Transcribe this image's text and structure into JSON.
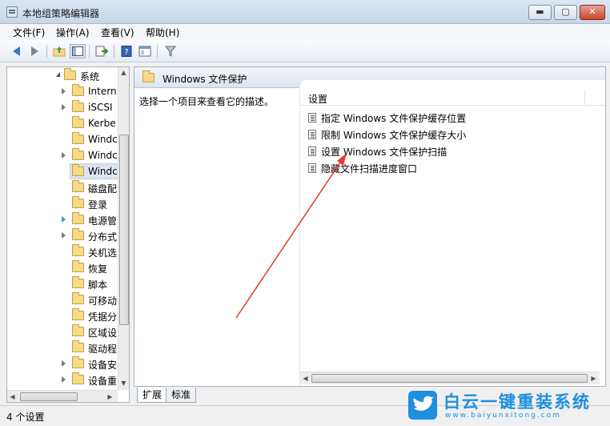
{
  "window": {
    "title": "本地组策略编辑器",
    "min_label": "▬",
    "max_label": "▢",
    "close_label": "✕"
  },
  "menu": {
    "items": [
      "文件(F)",
      "操作(A)",
      "查看(V)",
      "帮助(H)"
    ]
  },
  "toolbar": {
    "icons": [
      "back-arrow-icon",
      "forward-arrow-icon",
      "up-folder-icon",
      "show-hide-tree-icon",
      "export-list-icon",
      "help-icon",
      "properties-icon",
      "filter-icon"
    ]
  },
  "tree": {
    "items": [
      {
        "label": "系统",
        "expander": "open"
      },
      {
        "label": "Intern",
        "expander": "closed"
      },
      {
        "label": "iSCSI",
        "expander": "closed"
      },
      {
        "label": "Kerbe",
        "expander": "none"
      },
      {
        "label": "Windc",
        "expander": "none"
      },
      {
        "label": "Windc",
        "expander": "closed"
      },
      {
        "label": "Windc",
        "expander": "none",
        "selected": true
      },
      {
        "label": "磁盘配",
        "expander": "none"
      },
      {
        "label": "登录",
        "expander": "none"
      },
      {
        "label": "电源管",
        "expander": "blue"
      },
      {
        "label": "分布式",
        "expander": "closed"
      },
      {
        "label": "关机选",
        "expander": "none"
      },
      {
        "label": "恢复",
        "expander": "none"
      },
      {
        "label": "脚本",
        "expander": "none"
      },
      {
        "label": "可移动",
        "expander": "none"
      },
      {
        "label": "凭据分",
        "expander": "none"
      },
      {
        "label": "区域设",
        "expander": "none"
      },
      {
        "label": "驱动程",
        "expander": "none"
      },
      {
        "label": "设备安",
        "expander": "closed"
      },
      {
        "label": "设备重",
        "expander": "closed"
      }
    ]
  },
  "details": {
    "header_title": "Windows 文件保护",
    "description": "选择一个项目来查看它的描述。",
    "column_header": "设置",
    "settings": [
      "指定 Windows 文件保护缓存位置",
      "限制 Windows 文件保护缓存大小",
      "设置 Windows 文件保护扫描",
      "隐藏文件扫描进度窗口"
    ]
  },
  "tabs": {
    "expand": "扩展",
    "standard": "标准"
  },
  "status": {
    "text": "4 个设置"
  },
  "watermark": {
    "title": "白云一键重装系统",
    "url": "www.baiyunxitong.com"
  },
  "colors": {
    "annotation_arrow": "#e53b2c",
    "watermark": "#1f8fde"
  }
}
